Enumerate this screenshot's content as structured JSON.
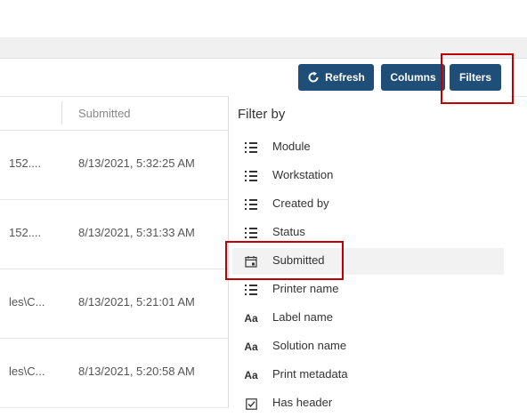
{
  "toolbar": {
    "refresh_label": "Refresh",
    "columns_label": "Columns",
    "filters_label": "Filters",
    "accent_color": "#1f4e79",
    "highlight_color": "#c00000"
  },
  "table": {
    "header": "Submitted",
    "rows": [
      {
        "col_a": "152....",
        "submitted": "8/13/2021, 5:32:25 AM"
      },
      {
        "col_a": "152....",
        "submitted": "8/13/2021, 5:31:33 AM"
      },
      {
        "col_a": "les\\C...",
        "submitted": "8/13/2021, 5:21:01 AM"
      },
      {
        "col_a": "les\\C...",
        "submitted": "8/13/2021, 5:20:58 AM"
      }
    ]
  },
  "filter_panel": {
    "title": "Filter by",
    "items": [
      {
        "label": "Module",
        "icon": "list-icon"
      },
      {
        "label": "Workstation",
        "icon": "list-icon"
      },
      {
        "label": "Created by",
        "icon": "list-icon"
      },
      {
        "label": "Status",
        "icon": "list-icon"
      },
      {
        "label": "Submitted",
        "icon": "calendar-icon",
        "selected": true
      },
      {
        "label": "Printer name",
        "icon": "list-icon"
      },
      {
        "label": "Label name",
        "icon": "text-icon"
      },
      {
        "label": "Solution name",
        "icon": "text-icon"
      },
      {
        "label": "Print metadata",
        "icon": "text-icon"
      },
      {
        "label": "Has header",
        "icon": "checkbox-icon"
      }
    ]
  }
}
